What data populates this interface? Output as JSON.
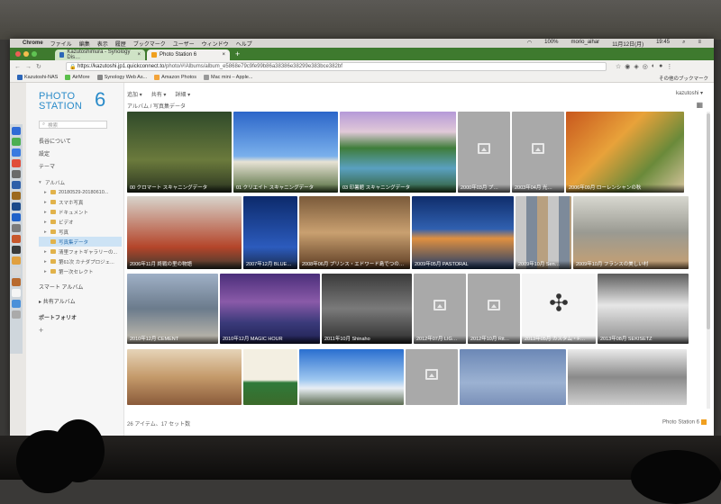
{
  "mac_menu": {
    "app": "Chrome",
    "items": [
      "ファイル",
      "編集",
      "表示",
      "履歴",
      "ブックマーク",
      "ユーザー",
      "ウィンドウ",
      "ヘルプ"
    ],
    "status": [
      "100%",
      "morio_aihar",
      "11月12日(月)",
      "19:45"
    ]
  },
  "browser": {
    "tabs": [
      {
        "label": "Kazutoshimura - Synology Dis…",
        "active": false
      },
      {
        "label": "Photo Station 6",
        "active": true
      }
    ],
    "url_host": "https://kazutoshi.jp1.quickconnect.to",
    "url_path": "/photo/#!Albums/album_e5868e79c9fe99b86a38386e38299e383bce382bf",
    "bookmarks": [
      "Kazutoshi-NAS",
      "AirMore",
      "Synology Web As...",
      "Amazon Photos",
      "Mac mini – Apple..."
    ],
    "bookmarks_other": "その他のブックマーク"
  },
  "app": {
    "logo_line1": "PHOTO",
    "logo_line2": "STATION",
    "logo_number": "6",
    "search_placeholder": "検索",
    "nav": [
      "長谷について",
      "設定",
      "テーマ"
    ],
    "tree": [
      {
        "label": "アルバム",
        "level": 0,
        "selected": false
      },
      {
        "label": "20180529-20180610...",
        "level": 1,
        "selected": false
      },
      {
        "label": "スマホ写真",
        "level": 1,
        "selected": false
      },
      {
        "label": "ドキュメント",
        "level": 1,
        "selected": false
      },
      {
        "label": "ビデオ",
        "level": 1,
        "selected": false
      },
      {
        "label": "写真",
        "level": 1,
        "selected": false
      },
      {
        "label": "写真集データ",
        "level": 1,
        "selected": true
      },
      {
        "label": "清里フォトギャラリーの...",
        "level": 1,
        "selected": false
      },
      {
        "label": "第61次 カナダプロジェ...",
        "level": 1,
        "selected": false
      },
      {
        "label": "第一次セレクト",
        "level": 1,
        "selected": false
      }
    ],
    "smart_album": "スマート アルバム",
    "shared_album": "共有アルバム",
    "portfolio": "ポートフォリオ",
    "add": "+",
    "toolbar": [
      "追加",
      "共有",
      "詳細"
    ],
    "breadcrumb": "アルバム  /  写真集データ",
    "user": "kazutoshi ▾",
    "status": "26 アイテム、17 セット数",
    "footer_brand": "Photo Station 6"
  },
  "tiles": [
    {
      "caption": "00  クロマート  スキャニングデータ",
      "style": "forest",
      "placeholder": false
    },
    {
      "caption": "01  クリエイト  スキャニングデータ",
      "style": "church",
      "placeholder": false
    },
    {
      "caption": "03  印暑館  スキャニングデータ",
      "style": "farm",
      "placeholder": false
    },
    {
      "caption": "2000年03月  プ…",
      "style": "gray",
      "placeholder": true
    },
    {
      "caption": "2003年04月  光…",
      "style": "gray",
      "placeholder": true
    },
    {
      "caption": "2006年09月  ローレンシャンの秋",
      "style": "autumn",
      "placeholder": false
    },
    {
      "caption": "2006年11月  終戦の里の物語",
      "style": "house",
      "placeholder": false
    },
    {
      "caption": "2007年12月  BLUE…",
      "style": "lighthouse",
      "placeholder": false
    },
    {
      "caption": "2008年06月  プリンス・エドワード島でつの…",
      "style": "classroom",
      "placeholder": false
    },
    {
      "caption": "2009年05月  PASTORAL",
      "style": "pastoral",
      "placeholder": false
    },
    {
      "caption": "2009年10月  Sen…",
      "style": "collage",
      "placeholder": false
    },
    {
      "caption": "2009年10月  フランスの美しい村",
      "style": "market",
      "placeholder": false
    },
    {
      "caption": "2010年12月  CEMENT",
      "style": "city",
      "placeholder": false
    },
    {
      "caption": "2010年12月  MAGIC HOUR",
      "style": "magic",
      "placeholder": false
    },
    {
      "caption": "2011年10月  Shinaho",
      "style": "machine",
      "placeholder": false
    },
    {
      "caption": "2012年07月  LIG…",
      "style": "gray",
      "placeholder": true
    },
    {
      "caption": "2012年10月  Rit…",
      "style": "gray",
      "placeholder": true
    },
    {
      "caption": "2013年05月  カスタム・F…",
      "style": "compass",
      "placeholder": false
    },
    {
      "caption": "2013年08月  SEKISETZ",
      "style": "snow",
      "placeholder": false
    },
    {
      "caption": "",
      "style": "shop",
      "placeholder": false
    },
    {
      "caption": "",
      "style": "poster",
      "placeholder": false
    },
    {
      "caption": "",
      "style": "sky",
      "placeholder": false
    },
    {
      "caption": "",
      "style": "gray",
      "placeholder": true
    },
    {
      "caption": "",
      "style": "mist",
      "placeholder": false
    },
    {
      "caption": "",
      "style": "bw",
      "placeholder": false
    }
  ]
}
